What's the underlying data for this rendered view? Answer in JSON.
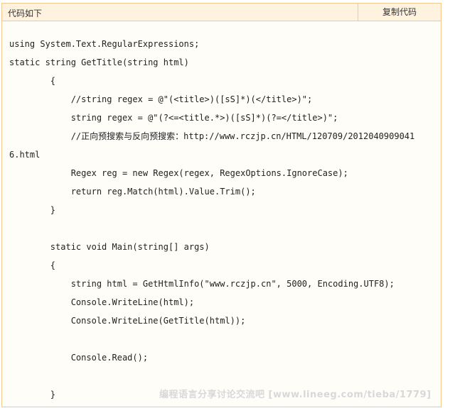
{
  "header": {
    "title": "代码如下",
    "copy_label": "复制代码"
  },
  "code_lines": [
    "using System.Text.RegularExpressions;",
    "static string GetTitle(string html)",
    "        {",
    "            //string regex = @\"(<title>)([sS]*)(</title>)\";",
    "            string regex = @\"(?<=<title.*>)([sS]*)(?=</title>)\";",
    "            //正向预搜索与反向预搜索：http://www.rczjp.cn/HTML/120709/2012040909041",
    "6.html",
    "            Regex reg = new Regex(regex, RegexOptions.IgnoreCase);",
    "            return reg.Match(html).Value.Trim();",
    "        }",
    "",
    "        static void Main(string[] args)",
    "        {",
    "            string html = GetHtmlInfo(\"www.rczjp.cn\", 5000, Encoding.UTF8);",
    "            Console.WriteLine(html);",
    "            Console.WriteLine(GetTitle(html));",
    "",
    "            Console.Read();",
    "",
    "        }"
  ],
  "watermark": "编程语言分享讨论交流吧 [www.lineeg.com/tieba/1779]"
}
